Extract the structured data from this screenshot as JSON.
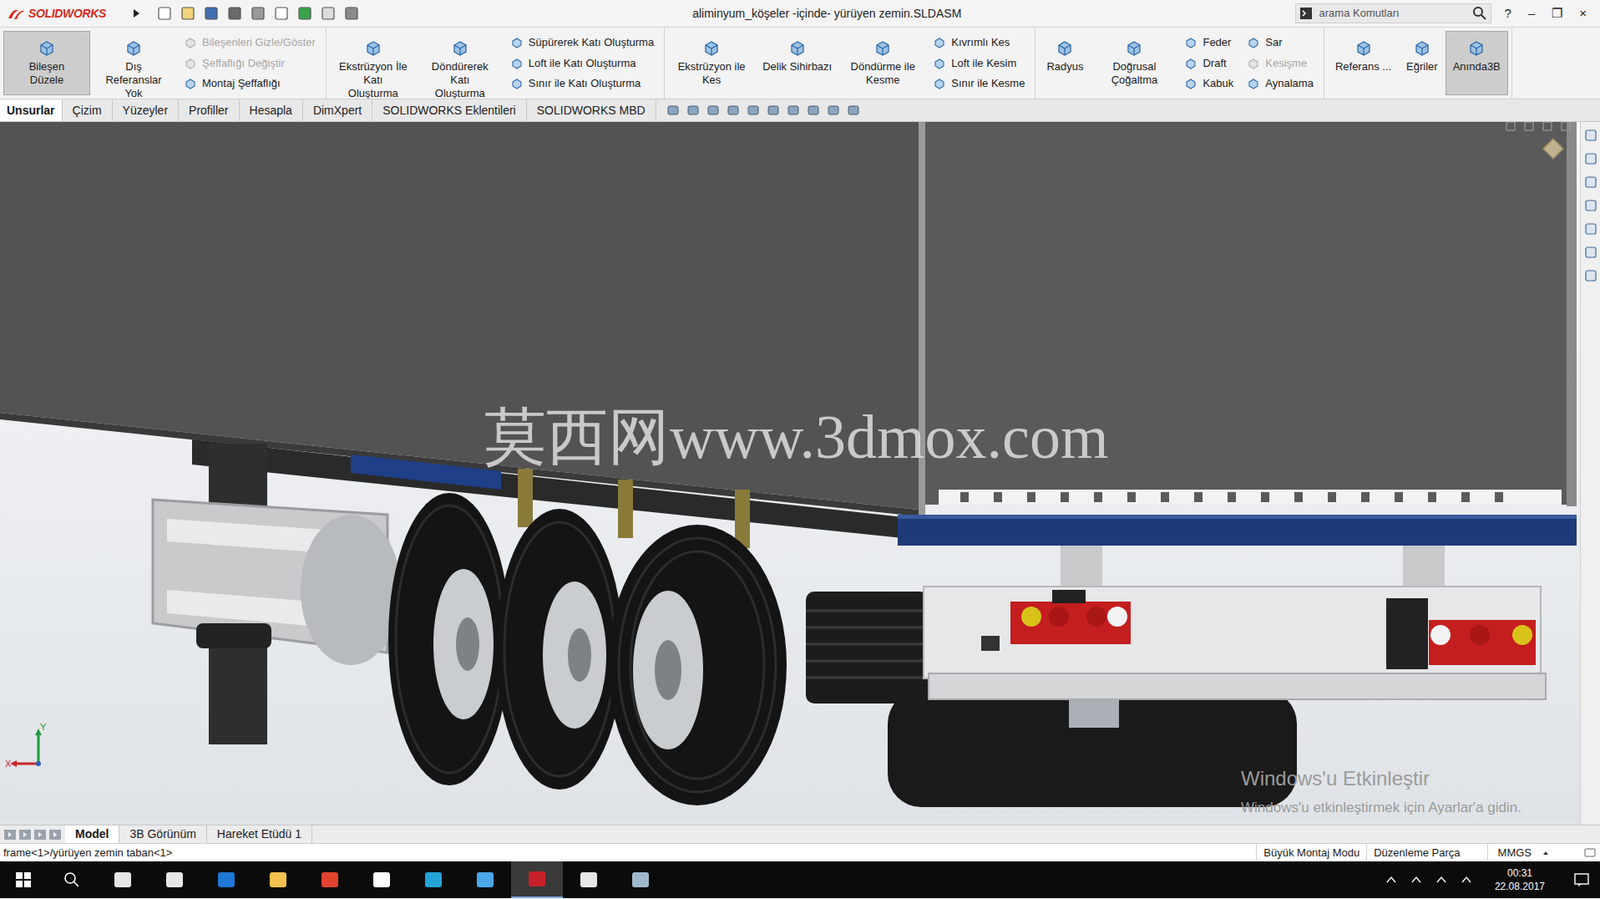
{
  "window": {
    "app": "SOLIDWORKS",
    "title": "aliminyum_köşeler -içinde- yürüyen zemin.SLDASM",
    "controls": [
      "?",
      "–",
      "❐",
      "×"
    ]
  },
  "search": {
    "placeholder": "arama Komutları"
  },
  "ribbon": {
    "groups": [
      {
        "items": [
          {
            "kind": "large",
            "label": "Bileşen Düzele",
            "selected": true
          },
          {
            "kind": "large",
            "label": "Dış Referanslar Yok",
            "selected": false
          },
          {
            "kind": "column",
            "entries": [
              {
                "label": "Bileşenleri Gizle/Göster",
                "disabled": true
              },
              {
                "label": "Şeffaflığı Değiştir",
                "disabled": true
              },
              {
                "label": "Montaj Şeffaflığı",
                "disabled": false
              }
            ]
          }
        ]
      },
      {
        "items": [
          {
            "kind": "large",
            "label": "Ekstrüzyon İle Katı Oluşturma",
            "selected": false
          },
          {
            "kind": "large",
            "label": "Döndürerek Katı Oluşturma",
            "selected": false
          },
          {
            "kind": "column",
            "entries": [
              {
                "label": "Süpürerek Katı Oluşturma",
                "disabled": false
              },
              {
                "label": "Loft ile Katı Oluşturma",
                "disabled": false
              },
              {
                "label": "Sınır ile Katı Oluşturma",
                "disabled": false
              }
            ]
          }
        ]
      },
      {
        "items": [
          {
            "kind": "large",
            "label": "Ekstrüzyon ile Kes",
            "selected": false
          },
          {
            "kind": "large",
            "label": "Delik Sihirbazı",
            "selected": false
          },
          {
            "kind": "large",
            "label": "Döndürme ile Kesme",
            "selected": false
          },
          {
            "kind": "column",
            "entries": [
              {
                "label": "Kıvrımlı Kes",
                "disabled": false
              },
              {
                "label": "Loft ile Kesim",
                "disabled": false
              },
              {
                "label": "Sınır ile Kesme",
                "disabled": false
              }
            ]
          }
        ]
      },
      {
        "items": [
          {
            "kind": "large",
            "label": "Radyus",
            "selected": false
          },
          {
            "kind": "large",
            "label": "Doğrusal Çoğaltma",
            "selected": false
          },
          {
            "kind": "column",
            "entries": [
              {
                "label": "Feder",
                "disabled": false
              },
              {
                "label": "Draft",
                "disabled": false
              },
              {
                "label": "Kabuk",
                "disabled": false
              }
            ]
          },
          {
            "kind": "column",
            "entries": [
              {
                "label": "Sar",
                "disabled": false
              },
              {
                "label": "Kesişme",
                "disabled": true
              },
              {
                "label": "Aynalama",
                "disabled": false
              }
            ]
          }
        ]
      },
      {
        "items": [
          {
            "kind": "large",
            "label": "Referans ...",
            "selected": false
          },
          {
            "kind": "large",
            "label": "Eğriler",
            "selected": false
          },
          {
            "kind": "large",
            "label": "Anında3B",
            "selected": true
          }
        ]
      }
    ]
  },
  "tabs": [
    {
      "label": "Unsurlar",
      "selected": true
    },
    {
      "label": "Çizim",
      "selected": false
    },
    {
      "label": "Yüzeyler",
      "selected": false
    },
    {
      "label": "Profiller",
      "selected": false
    },
    {
      "label": "Hesapla",
      "selected": false
    },
    {
      "label": "DimXpert",
      "selected": false
    },
    {
      "label": "SOLIDWORKS Eklentileri",
      "selected": false
    },
    {
      "label": "SOLIDWORKS MBD",
      "selected": false
    }
  ],
  "viewport": {
    "watermark": "莫西网www.3dmox.com",
    "activation": {
      "title": "Windows'u Etkinleştir",
      "text": "Windows'u etkinleştirmek için Ayarlar'a gidin."
    },
    "axes": {
      "y": "Y",
      "x": "X"
    }
  },
  "bottom_tabs": [
    {
      "label": "Model",
      "selected": true
    },
    {
      "label": "3B Görünüm",
      "selected": false
    },
    {
      "label": "Hareket Etüdü 1",
      "selected": false
    }
  ],
  "status_bar": {
    "path": "frame<1>/yürüyen zemin taban<1>",
    "items": [
      "Büyük Montaj Modu",
      "Düzenleme Parça",
      "MMGS"
    ]
  },
  "taskbar": {
    "time": "00:31",
    "date": "22.08.2017"
  }
}
